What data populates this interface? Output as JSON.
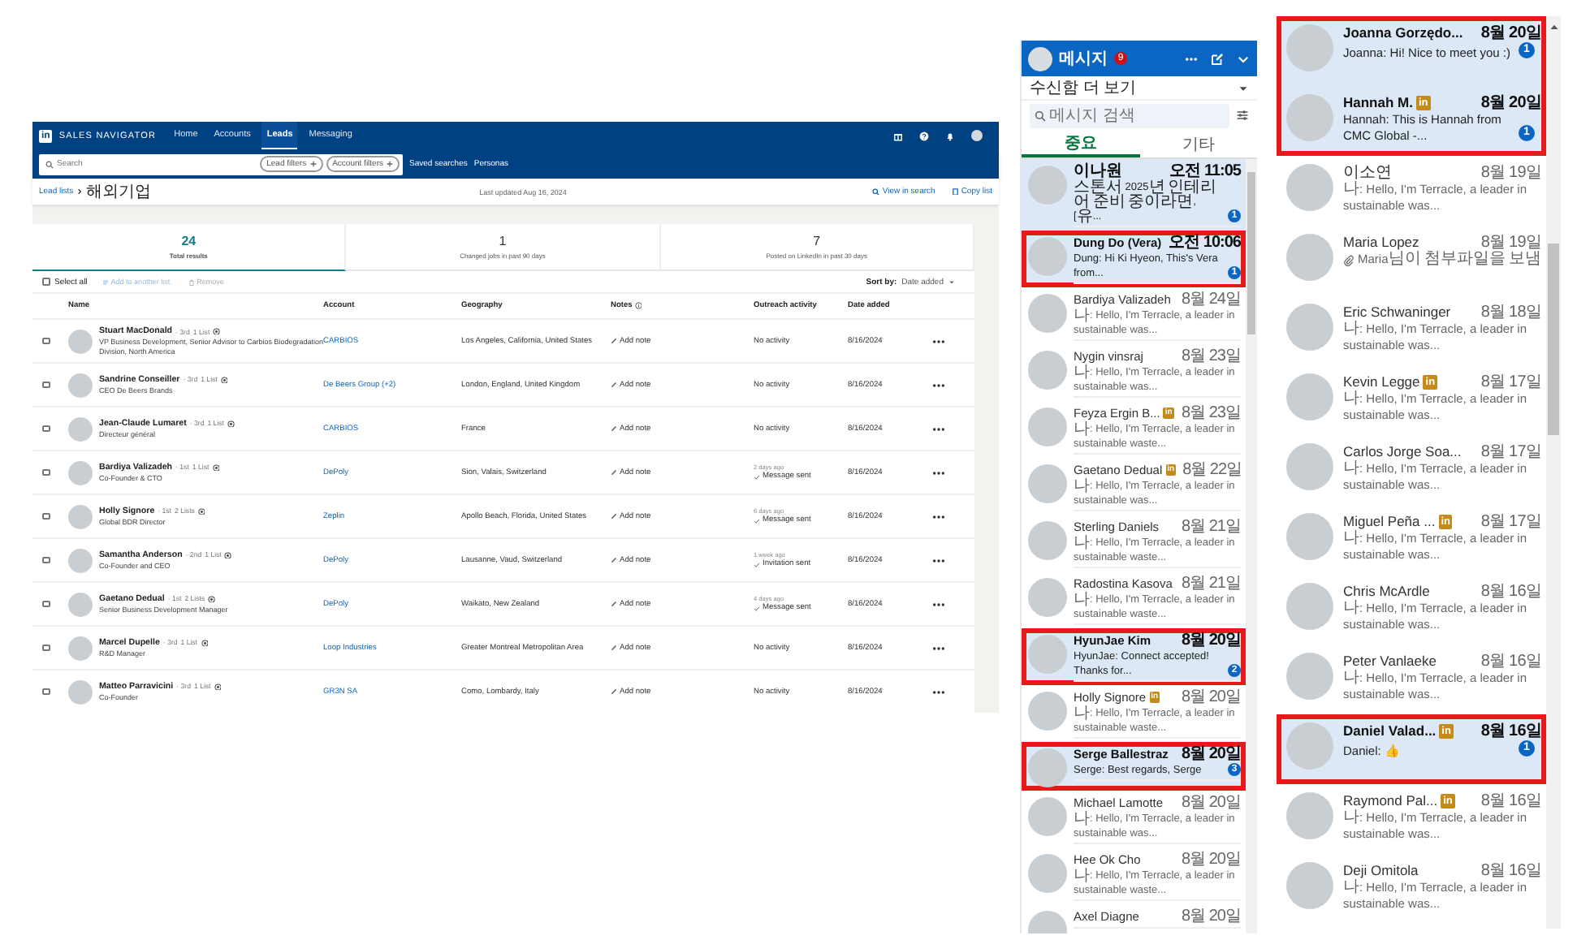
{
  "sales_navigator": {
    "logo": "in",
    "brand": "SALES NAVIGATOR",
    "nav": [
      {
        "label": "Home",
        "selected": false
      },
      {
        "label": "Accounts",
        "selected": false
      },
      {
        "label": "Leads",
        "selected": true
      },
      {
        "label": "Messaging",
        "selected": false
      }
    ],
    "search": {
      "placeholder": "Search"
    },
    "filters": [
      "Lead filters",
      "Account filters"
    ],
    "links": [
      "Saved searches",
      "Personas"
    ],
    "breadcrumb": {
      "parent": "Lead lists",
      "current": "해외기업"
    },
    "last_updated": "Last updated Aug 16, 2024",
    "actions": [
      {
        "kind": "search",
        "label": "View in search"
      },
      {
        "kind": "copy",
        "label": "Copy list"
      }
    ],
    "stats": [
      {
        "value": "24",
        "label": "Total results",
        "selected": true
      },
      {
        "value": "1",
        "label": "Changed jobs in past 90 days",
        "selected": false
      },
      {
        "value": "7",
        "label": "Posted on LinkedIn in past 30 days",
        "selected": false
      }
    ],
    "toolbar": {
      "select_all": {
        "label": "Select all",
        "checked": false
      },
      "actions": [
        {
          "kind": "add",
          "label": "Add to another list",
          "disabled": true
        },
        {
          "kind": "remove",
          "label": "Remove",
          "disabled": true
        }
      ],
      "sort_label": "Sort by:",
      "sort_value": "Date added"
    },
    "columns": [
      {
        "label": "Name",
        "info": false
      },
      {
        "label": "Account",
        "info": false
      },
      {
        "label": "Geography",
        "info": false
      },
      {
        "label": "Notes",
        "info": true
      },
      {
        "label": "Outreach activity",
        "info": false
      },
      {
        "label": "Date added",
        "info": false
      }
    ],
    "rows": [
      {
        "checked": false,
        "name": "Stuart MacDonald",
        "degree": "· 3rd",
        "lists": "1 List",
        "title": "VP Business Development, Senior Advisor to Carbios Biodegradation Division, North America",
        "account": "CARBIOS",
        "geography": "Los Angeles, California, United States",
        "note": "Add note",
        "activity": {
          "kind": "none",
          "text": "No activity"
        },
        "date": "8/16/2024"
      },
      {
        "checked": false,
        "name": "Sandrine Conseiller",
        "degree": "· 3rd",
        "lists": "1 List",
        "title": "CEO De Beers Brands",
        "account": "De Beers Group (+2)",
        "geography": "London, England, United Kingdom",
        "note": "Add note",
        "activity": {
          "kind": "none",
          "text": "No activity"
        },
        "date": "8/16/2024"
      },
      {
        "checked": false,
        "name": "Jean-Claude Lumaret",
        "degree": "· 3rd",
        "lists": "1 List",
        "title": "Directeur général",
        "account": "CARBIOS",
        "geography": "France",
        "note": "Add note",
        "activity": {
          "kind": "none",
          "text": "No activity"
        },
        "date": "8/16/2024"
      },
      {
        "checked": false,
        "name": "Bardiya Valizadeh",
        "degree": "· 1st",
        "lists": "1 List",
        "title": "Co-Founder & CTO",
        "account": "DePoly",
        "geography": "Sion, Valais, Switzerland",
        "note": "Add note",
        "activity": {
          "kind": "sent",
          "time": "2 days ago",
          "text": "Message sent"
        },
        "date": "8/16/2024"
      },
      {
        "checked": false,
        "name": "Holly Signore",
        "degree": "· 1st",
        "lists": "2 Lists",
        "title": "Global BDR Director",
        "account": "Zeplin",
        "geography": "Apollo Beach, Florida, United States",
        "note": "Add note",
        "activity": {
          "kind": "sent",
          "time": "6 days ago",
          "text": "Message sent"
        },
        "date": "8/16/2024"
      },
      {
        "checked": false,
        "name": "Samantha Anderson",
        "degree": "· 2nd",
        "lists": "1 List",
        "title": "Co-Founder and CEO",
        "account": "DePoly",
        "geography": "Lausanne, Vaud, Switzerland",
        "note": "Add note",
        "activity": {
          "kind": "sent",
          "time": "1 week ago",
          "text": "Invitation sent"
        },
        "date": "8/16/2024"
      },
      {
        "checked": false,
        "name": "Gaetano Dedual",
        "degree": "· 1st",
        "lists": "2 Lists",
        "title": "Senior Business Development Manager",
        "account": "DePoly",
        "geography": "Waikato, New Zealand",
        "note": "Add note",
        "activity": {
          "kind": "sent",
          "time": "4 days ago",
          "text": "Message sent"
        },
        "date": "8/16/2024"
      },
      {
        "checked": false,
        "name": "Marcel Dupelle",
        "degree": "· 3rd",
        "lists": "1 List",
        "title": "R&D Manager",
        "account": "Loop Industries",
        "geography": "Greater Montreal Metropolitan Area",
        "note": "Add note",
        "activity": {
          "kind": "none",
          "text": "No activity"
        },
        "date": "8/16/2024"
      },
      {
        "checked": false,
        "name": "Matteo Parravicini",
        "degree": "· 3rd",
        "lists": "1 List",
        "title": "Co-Founder",
        "account": "GR3N SA",
        "geography": "Como, Lombardy, Italy",
        "note": "Add note",
        "activity": {
          "kind": "none",
          "text": "No activity"
        },
        "date": "8/16/2024"
      }
    ]
  },
  "messaging": {
    "title": "메시지",
    "unread_count": "9",
    "filter": "수신함 더 보기",
    "search": {
      "placeholder": "메시지 검색"
    },
    "tabs": [
      {
        "label": "중요",
        "selected": true
      },
      {
        "label": "기타",
        "selected": false
      }
    ],
    "conversations": [
      {
        "name": "이나원",
        "date": "오전 11:05",
        "preview": "스톤서 2025년 인테리어 준비 중이라면, [유...",
        "unread": true,
        "badge": "1",
        "highlighted": false
      },
      {
        "name": "Dung Do (Vera)",
        "date": "오전 10:06",
        "preview": "Dung: Hi Ki Hyeon, This's Vera from...",
        "unread": true,
        "badge": "1",
        "highlighted": true
      },
      {
        "name": "Bardiya Valizadeh",
        "date": "8월 24일",
        "preview": "나: Hello, I'm Terracle, a leader in sustainable was...",
        "unread": false,
        "highlighted": false
      },
      {
        "name": "Nygin vinsraj",
        "date": "8월 23일",
        "preview": "나: Hello, I'm Terracle, a leader in sustainable was...",
        "unread": false,
        "highlighted": false
      },
      {
        "name": "Feyza Ergin B...",
        "premium": "in",
        "date": "8월 23일",
        "preview": "나: Hello, I'm Terracle, a leader in sustainable waste...",
        "unread": false,
        "highlighted": false
      },
      {
        "name": "Gaetano Dedual",
        "premium": "in",
        "date": "8월 22일",
        "preview": "나: Hello, I'm Terracle, a leader in sustainable was...",
        "unread": false,
        "highlighted": false
      },
      {
        "name": "Sterling Daniels",
        "date": "8월 21일",
        "preview": "나: Hello, I'm Terracle, a leader in sustainable waste...",
        "unread": false,
        "highlighted": false
      },
      {
        "name": "Radostina Kasova",
        "date": "8월 21일",
        "preview": "나: Hello, I'm Terracle, a leader in sustainable waste...",
        "unread": false,
        "highlighted": false
      },
      {
        "name": "HyunJae Kim",
        "date": "8월 20일",
        "preview": "HyunJae: Connect accepted! Thanks for...",
        "unread": true,
        "badge": "2",
        "highlighted": true
      },
      {
        "name": "Holly Signore",
        "premium": "in",
        "date": "8월 20일",
        "preview": "나: Hello, I'm Terracle, a leader in sustainable waste...",
        "unread": false,
        "highlighted": false
      },
      {
        "name": "Serge Ballestraz",
        "date": "8월 20일",
        "preview": "Serge: Best regards, Serge",
        "unread": true,
        "badge": "3",
        "highlighted": true
      },
      {
        "name": "Michael Lamotte",
        "date": "8월 20일",
        "preview": "나: Hello, I'm Terracle, a leader in sustainable was...",
        "unread": false,
        "highlighted": false
      },
      {
        "name": "Hee Ok Cho",
        "date": "8월 20일",
        "preview": "나: Hello, I'm Terracle, a leader in sustainable waste...",
        "unread": false,
        "highlighted": false
      },
      {
        "name": "Axel Diagne",
        "date": "8월 20일",
        "unread": false,
        "highlighted": false
      }
    ]
  },
  "messaging_continued": {
    "conversations": [
      {
        "name": "Joanna Gorzędo...",
        "date": "8월 20일",
        "preview": "Joanna: Hi! Nice to meet you :)",
        "unread": true,
        "badge": "1",
        "highlighted": true
      },
      {
        "name": "Hannah M.",
        "premium": "in",
        "date": "8월 20일",
        "preview": "Hannah: This is Hannah from CMC Global -...",
        "unread": true,
        "badge": "1",
        "highlighted": true
      },
      {
        "name": "이소연",
        "date": "8월 19일",
        "preview": "나: Hello, I'm Terracle, a leader in sustainable was...",
        "unread": false,
        "highlighted": false
      },
      {
        "name": "Maria Lopez",
        "date": "8월 19일",
        "preview": "Maria님이 첨부파일을 보냄",
        "attachment": true,
        "unread": false,
        "highlighted": false
      },
      {
        "name": "Eric Schwaninger",
        "date": "8월 18일",
        "preview": "나: Hello, I'm Terracle, a leader in sustainable was...",
        "unread": false,
        "highlighted": false
      },
      {
        "name": "Kevin Legge",
        "premium": "in",
        "date": "8월 17일",
        "preview": "나: Hello, I'm Terracle, a leader in sustainable was...",
        "unread": false,
        "highlighted": false
      },
      {
        "name": "Carlos Jorge Soa...",
        "date": "8월 17일",
        "preview": "나: Hello, I'm Terracle, a leader in sustainable was...",
        "unread": false,
        "highlighted": false
      },
      {
        "name": "Miguel Peña ...",
        "premium": "in",
        "date": "8월 17일",
        "preview": "나: Hello, I'm Terracle, a leader in sustainable was...",
        "unread": false,
        "highlighted": false
      },
      {
        "name": "Chris McArdle",
        "date": "8월 16일",
        "preview": "나: Hello, I'm Terracle, a leader in sustainable was...",
        "unread": false,
        "highlighted": false
      },
      {
        "name": "Peter Vanlaeke",
        "date": "8월 16일",
        "preview": "나: Hello, I'm Terracle, a leader in sustainable was...",
        "unread": false,
        "highlighted": false
      },
      {
        "name": "Daniel Valad...",
        "premium": "in",
        "date": "8월 16일",
        "preview": "Daniel: 👍",
        "unread": true,
        "badge": "1",
        "highlighted": true
      },
      {
        "name": "Raymond Pal...",
        "premium": "in",
        "date": "8월 16일",
        "preview": "나: Hello, I'm Terracle, a leader in sustainable was...",
        "unread": false,
        "highlighted": false
      },
      {
        "name": "Deji Omitola",
        "date": "8월 16일",
        "preview": "나: Hello, I'm Terracle, a leader in sustainable was...",
        "unread": false,
        "highlighted": false
      }
    ]
  }
}
